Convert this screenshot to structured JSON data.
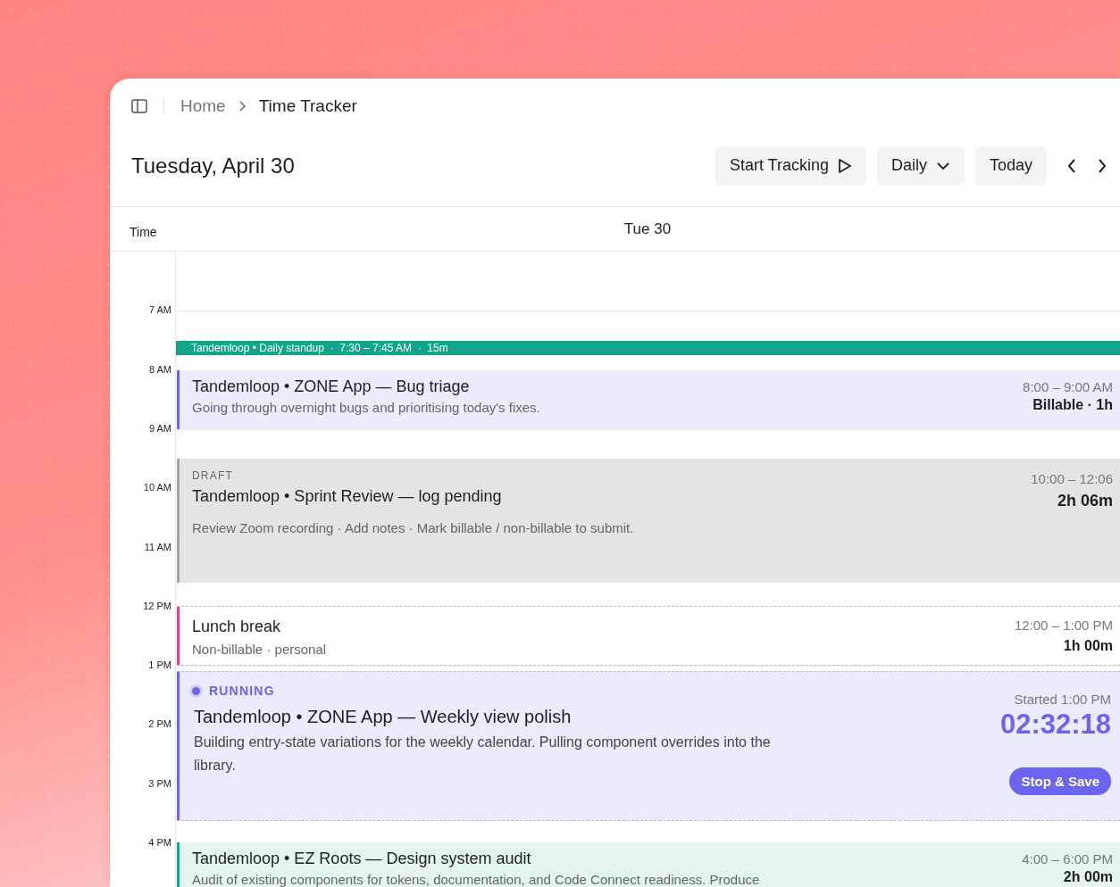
{
  "breadcrumb": {
    "items": [
      "Home",
      "Time Tracker"
    ]
  },
  "header": {
    "title": "Tuesday, April 30",
    "buttons": [
      {
        "label": "Start Tracking",
        "kind": "play"
      },
      {
        "label": "Daily",
        "kind": "dropdown"
      },
      {
        "label": "Today",
        "kind": "plain"
      }
    ]
  },
  "columns": {
    "time": "Time",
    "day": "Tue 30"
  },
  "hours": [
    "7 AM",
    "8 AM",
    "9 AM",
    "10 AM",
    "11 AM",
    "12 PM",
    "1 PM",
    "2 PM",
    "3 PM",
    "4 PM"
  ],
  "events": [
    {
      "kind": "strip",
      "title": "Tandemloop • Daily standup  ·  7:30 – 7:45 AM  ·  15m",
      "color": "#13a589"
    },
    {
      "kind": "entry",
      "title": "Tandemloop • ZONE App — Bug triage",
      "note": "Going through overnight bugs and prioritising today's fixes.",
      "time": "8:00 – 9:00 AM",
      "duration": "Billable · 1h",
      "color": "#6b63e6"
    },
    {
      "kind": "draft",
      "tag": "DRAFT",
      "title": "Tandemloop • Sprint Review — log pending",
      "note": "Review Zoom recording · Add notes · Mark billable / non-billable to submit.",
      "time": "10:00 – 12:06",
      "duration": "2h 06m",
      "color": "#a3a3a3"
    },
    {
      "kind": "break",
      "title": "Lunch break",
      "note": "Non-billable · personal",
      "time": "12:00 – 1:00 PM",
      "duration": "1h 00m",
      "color": "#e0418a"
    },
    {
      "kind": "running",
      "tag": "RUNNING",
      "title": "Tandemloop • ZONE App — Weekly view polish",
      "note": "Building entry-state variations for the weekly calendar. Pulling component overrides into the library.",
      "time": "Started 1:00 PM",
      "duration": "02:32:18",
      "action": "Stop & Save",
      "color": "#6c63ee"
    },
    {
      "kind": "entry",
      "title": "Tandemloop • EZ Roots — Design system audit",
      "note": "Audit of existing components for tokens, documentation, and Code Connect readiness. Produce",
      "time": "4:00 – 6:00 PM",
      "duration": "2h 00m",
      "color": "#13a589"
    }
  ]
}
